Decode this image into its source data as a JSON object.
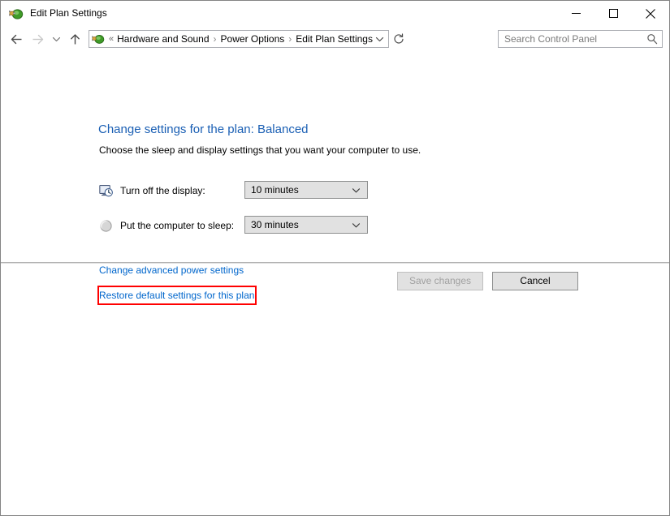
{
  "window": {
    "title": "Edit Plan Settings",
    "title_icon": "power-plan-icon",
    "controls": {
      "minimize": "Minimize",
      "maximize": "Maximize",
      "close": "Close"
    }
  },
  "nav": {
    "back": "Back",
    "forward": "Forward",
    "recent": "Recent locations",
    "up": "Up one level",
    "refresh": "Refresh",
    "breadcrumb": {
      "overflow": "«",
      "separator": "›",
      "items": [
        {
          "label": "Hardware and Sound"
        },
        {
          "label": "Power Options"
        },
        {
          "label": "Edit Plan Settings"
        }
      ]
    },
    "address_value": "Edit Plan Settings"
  },
  "search": {
    "placeholder": "Search Control Panel",
    "value": ""
  },
  "main": {
    "title": "Change settings for the plan: Balanced",
    "subtitle": "Choose the sleep and display settings that you want your computer to use.",
    "settings": [
      {
        "icon": "display-timeout-icon",
        "label": "Turn off the display:",
        "value": "10 minutes"
      },
      {
        "icon": "sleep-moon-icon",
        "label": "Put the computer to sleep:",
        "value": "30 minutes"
      }
    ],
    "links": [
      {
        "label": "Change advanced power settings"
      },
      {
        "label": "Restore default settings for this plan"
      }
    ]
  },
  "footer": {
    "save_label": "Save changes",
    "save_enabled": false,
    "cancel_label": "Cancel"
  },
  "annotation": {
    "highlight_color": "#ff0000",
    "target": "Restore default settings for this plan"
  },
  "colors": {
    "link": "#0066cc",
    "heading": "#1a5fb4",
    "control_face": "#e1e1e1",
    "control_border": "#8e8f8f",
    "window_border": "#848484"
  }
}
